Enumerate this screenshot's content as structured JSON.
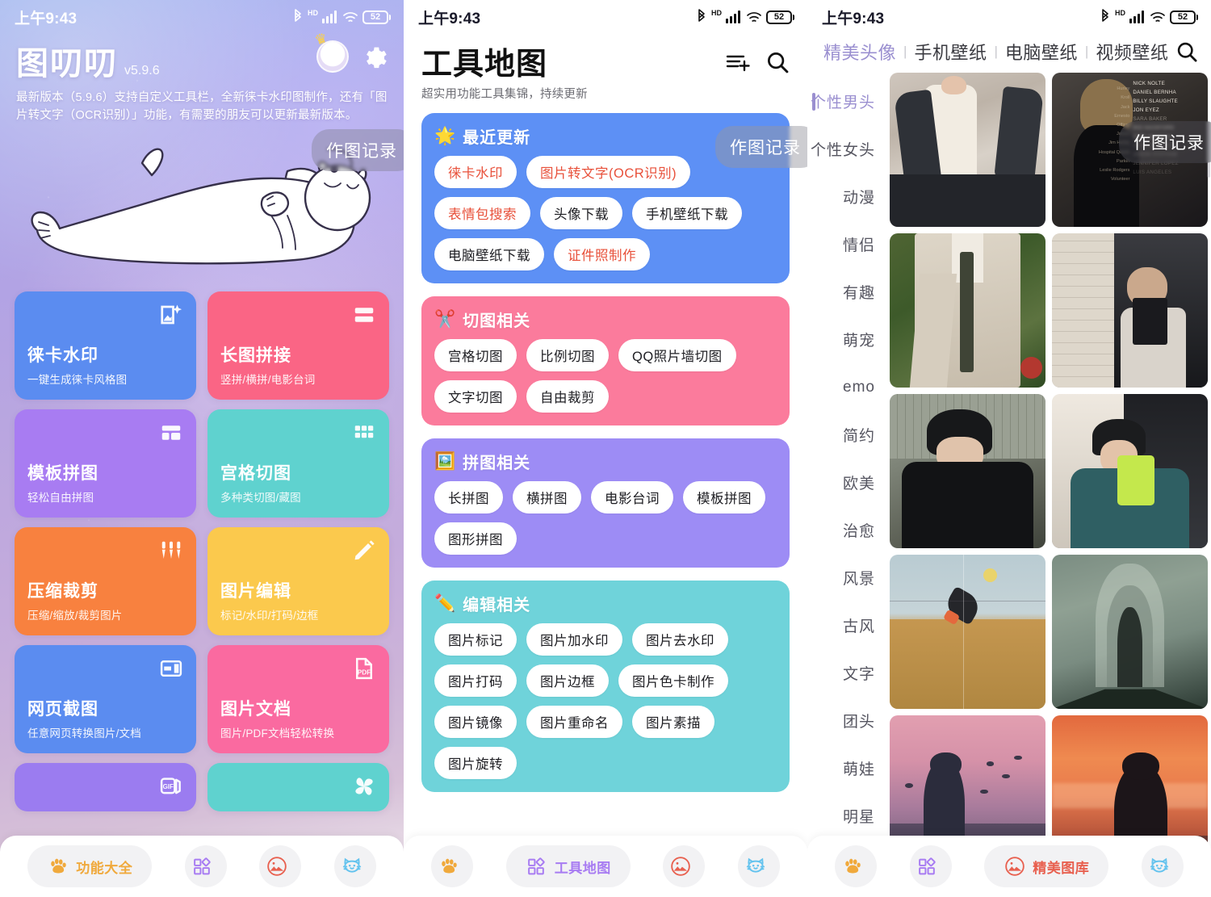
{
  "statusbar": {
    "time": "上午9:43",
    "battery": "52",
    "hd": "HD"
  },
  "screen1": {
    "app_title": "图叨叨",
    "version": "v5.9.6",
    "description": "最新版本（5.9.6）支持自定义工具栏，全新徕卡水印图制作，还有「图片转文字（OCR识别）」功能，有需要的朋友可以更新最新版本。",
    "float_button": "作图记录",
    "avatar_icon": "crowned-cat-avatar",
    "settings_icon": "gear-icon",
    "illustration": "lying-cat-illustration",
    "cards": [
      {
        "title": "徕卡水印",
        "sub": "一键生成徕卡风格图",
        "color": "#5b8cf0",
        "icon": "image-sparkle-icon"
      },
      {
        "title": "长图拼接",
        "sub": "竖拼/横拼/电影台词",
        "color": "#fa6585",
        "icon": "stack-rows-icon"
      },
      {
        "title": "模板拼图",
        "sub": "轻松自由拼图",
        "color": "#a87cf2",
        "icon": "layout-template-icon"
      },
      {
        "title": "宫格切图",
        "sub": "多种类切图/藏图",
        "color": "#5fd2cf",
        "icon": "grid-nine-icon"
      },
      {
        "title": "压缩裁剪",
        "sub": "压缩/缩放/裁剪图片",
        "color": "#f8813f",
        "icon": "sliders-icon"
      },
      {
        "title": "图片编辑",
        "sub": "标记/水印/打码/边框",
        "color": "#fbc94d",
        "icon": "pencil-icon"
      },
      {
        "title": "网页截图",
        "sub": "任意网页转换图片/文档",
        "color": "#5b8cf0",
        "icon": "webpage-capture-icon"
      },
      {
        "title": "图片文档",
        "sub": "图片/PDF文档轻松转换",
        "color": "#fa6aa0",
        "icon": "pdf-file-icon"
      },
      {
        "title": "",
        "sub": "",
        "color": "#9b7cf0",
        "icon": "gif-icon"
      },
      {
        "title": "",
        "sub": "",
        "color": "#5fd2cf",
        "icon": "pinwheel-icon"
      }
    ],
    "nav": [
      {
        "label": "功能大全",
        "icon": "paw-icon",
        "active": true,
        "accent": "#f0a93c"
      },
      {
        "label": "",
        "icon": "shapes-icon",
        "active": false,
        "accent": "#a87cf2"
      },
      {
        "label": "",
        "icon": "photo-mountain-icon",
        "active": false,
        "accent": "#e8604f"
      },
      {
        "label": "",
        "icon": "cat-face-icon",
        "active": false,
        "accent": "#64c3ee"
      }
    ]
  },
  "screen2": {
    "title": "工具地图",
    "subtitle": "超实用功能工具集锦，持续更新",
    "add_list_icon": "list-add-icon",
    "search_icon": "search-icon",
    "float_button": "作图记录",
    "sections": [
      {
        "title": "最近更新",
        "emoji": "🌟",
        "color": "#5d90f5",
        "chips": [
          {
            "label": "徕卡水印",
            "hot": true
          },
          {
            "label": "图片转文字(OCR识别)",
            "hot": true
          },
          {
            "label": "表情包搜索",
            "hot": true
          },
          {
            "label": "头像下载",
            "hot": false
          },
          {
            "label": "手机壁纸下载",
            "hot": false
          },
          {
            "label": "电脑壁纸下载",
            "hot": false
          },
          {
            "label": "证件照制作",
            "hot": true
          }
        ]
      },
      {
        "title": "切图相关",
        "emoji": "✂️",
        "color": "#fb7b9c",
        "chips": [
          {
            "label": "宫格切图",
            "hot": false
          },
          {
            "label": "比例切图",
            "hot": false
          },
          {
            "label": "QQ照片墙切图",
            "hot": false
          },
          {
            "label": "文字切图",
            "hot": false
          },
          {
            "label": "自由裁剪",
            "hot": false
          }
        ]
      },
      {
        "title": "拼图相关",
        "emoji": "🖼️",
        "color": "#9d8cf5",
        "chips": [
          {
            "label": "长拼图",
            "hot": false
          },
          {
            "label": "横拼图",
            "hot": false
          },
          {
            "label": "电影台词",
            "hot": false
          },
          {
            "label": "模板拼图",
            "hot": false
          },
          {
            "label": "图形拼图",
            "hot": false
          }
        ]
      },
      {
        "title": "编辑相关",
        "emoji": "✏️",
        "color": "#6fd3da",
        "chips": [
          {
            "label": "图片标记",
            "hot": false
          },
          {
            "label": "图片加水印",
            "hot": false
          },
          {
            "label": "图片去水印",
            "hot": false
          },
          {
            "label": "图片打码",
            "hot": false
          },
          {
            "label": "图片边框",
            "hot": false
          },
          {
            "label": "图片色卡制作",
            "hot": false
          },
          {
            "label": "图片镜像",
            "hot": false
          },
          {
            "label": "图片重命名",
            "hot": false
          },
          {
            "label": "图片素描",
            "hot": false
          },
          {
            "label": "图片旋转",
            "hot": false
          }
        ]
      }
    ],
    "nav": [
      {
        "label": "",
        "icon": "paw-icon",
        "active": false,
        "accent": "#f0a93c"
      },
      {
        "label": "工具地图",
        "icon": "shapes-icon",
        "active": true,
        "accent": "#a87cf2"
      },
      {
        "label": "",
        "icon": "photo-mountain-icon",
        "active": false,
        "accent": "#e8604f"
      },
      {
        "label": "",
        "icon": "cat-face-icon",
        "active": false,
        "accent": "#64c3ee"
      }
    ]
  },
  "screen3": {
    "tabs": [
      {
        "label": "精美头像",
        "active": true
      },
      {
        "label": "手机壁纸",
        "active": false
      },
      {
        "label": "电脑壁纸",
        "active": false
      },
      {
        "label": "视频壁纸",
        "active": false
      }
    ],
    "tab_separator": "|",
    "search_icon": "search-icon",
    "float_button": "作图记录",
    "categories": [
      {
        "label": "个性男头",
        "active": true
      },
      {
        "label": "个性女头",
        "active": false
      },
      {
        "label": "动漫",
        "active": false
      },
      {
        "label": "情侣",
        "active": false
      },
      {
        "label": "有趣",
        "active": false
      },
      {
        "label": "萌宠",
        "active": false
      },
      {
        "label": "emo",
        "active": false
      },
      {
        "label": "简约",
        "active": false
      },
      {
        "label": "欧美",
        "active": false
      },
      {
        "label": "治愈",
        "active": false
      },
      {
        "label": "风景",
        "active": false
      },
      {
        "label": "古风",
        "active": false
      },
      {
        "label": "文字",
        "active": false
      },
      {
        "label": "团头",
        "active": false
      },
      {
        "label": "萌娃",
        "active": false
      },
      {
        "label": "明星",
        "active": false
      }
    ],
    "photos": [
      {
        "name": "man-white-tank-top-jacket",
        "kind": "portrait-light"
      },
      {
        "name": "blonde-man-credits-overlay",
        "kind": "credits-dark"
      },
      {
        "name": "man-suit-tie-garden",
        "kind": "garden-suit"
      },
      {
        "name": "man-selfie-mirror-tiles",
        "kind": "mirror-selfie"
      },
      {
        "name": "man-black-beret-fence",
        "kind": "beret-grey"
      },
      {
        "name": "man-green-sweater-phone",
        "kind": "green-sweater"
      },
      {
        "name": "figure-falling-sky-field",
        "kind": "surreal-field"
      },
      {
        "name": "layered-silhouettes-fog",
        "kind": "fog-silhouette"
      },
      {
        "name": "silhouette-birds-dusk",
        "kind": "dusk-birds"
      },
      {
        "name": "silhouette-orange-sunset",
        "kind": "orange-sunset"
      }
    ],
    "nav": [
      {
        "label": "",
        "icon": "paw-icon",
        "active": false,
        "accent": "#f0a93c"
      },
      {
        "label": "",
        "icon": "shapes-icon",
        "active": false,
        "accent": "#a87cf2"
      },
      {
        "label": "精美图库",
        "icon": "photo-mountain-icon",
        "active": true,
        "accent": "#e8604f"
      },
      {
        "label": "",
        "icon": "cat-face-icon",
        "active": false,
        "accent": "#64c3ee"
      }
    ]
  }
}
